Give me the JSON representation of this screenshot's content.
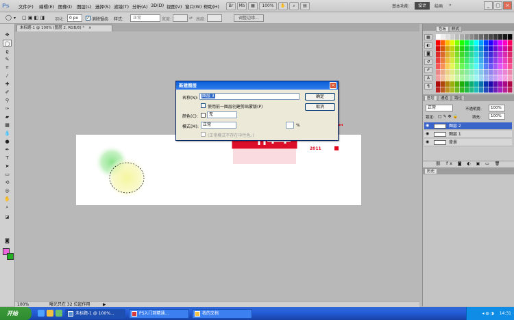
{
  "app": {
    "logo": "Ps"
  },
  "menu": [
    "文件(F)",
    "编辑(E)",
    "图像(I)",
    "图层(L)",
    "选择(S)",
    "滤镜(T)",
    "分析(A)",
    "3D(D)",
    "视图(V)",
    "窗口(W)",
    "帮助(H)"
  ],
  "menu_right": {
    "zoom": "100%",
    "workspaces": [
      "基本功能",
      "设计",
      "绘画"
    ],
    "active_workspace": "设计"
  },
  "options": {
    "feather_label": "羽化:",
    "feather_value": "0 px",
    "antialias_label": "消除锯齿",
    "style_label": "样式:",
    "style_value": "正常",
    "width_label": "宽度:",
    "height_label": "高度:",
    "refine_label": "调整边缘..."
  },
  "document_tab": {
    "title": "未标题-1 @ 100% (图层 2, RGB/8) *",
    "close": "×"
  },
  "status": {
    "zoom": "100%",
    "info": "曝光只在 32 位起作用"
  },
  "panels": {
    "swatches_tabs": [
      "色板",
      "样式"
    ],
    "layers_tabs": [
      "图层",
      "通道",
      "路径"
    ],
    "blend_mode": "正常",
    "opacity_label": "不透明度:",
    "opacity_value": "100%",
    "lock_label": "锁定:",
    "fill_label": "填充:",
    "fill_value": "100%",
    "layers": [
      {
        "name": "图层 2",
        "selected": true
      },
      {
        "name": "图层 1",
        "selected": false
      },
      {
        "name": "背景",
        "selected": false
      }
    ],
    "history_tab": "历史"
  },
  "dialog": {
    "title": "新建图层",
    "name_label": "名称(N):",
    "name_value": "图层 3",
    "clip_label": "使用前一图层创建剪贴蒙版(P)",
    "color_label": "颜色(C):",
    "color_value": "无",
    "mode_label": "模式(M):",
    "mode_value": "正常",
    "opacity_unit": "%",
    "neutral_label": "(正常模式不存在中性色。)",
    "ok_label": "确定",
    "cancel_label": "取消",
    "close": "×"
  },
  "if_logo": {
    "mark": "iF",
    "line1": "communication",
    "line2": "design",
    "line3": "award",
    "year": "2011"
  },
  "taskbar": {
    "start_label": "开始",
    "buttons": [
      {
        "label": "未标题-1 @ 100%...",
        "active": true
      },
      {
        "label": "PS入门到精通...",
        "active": false
      },
      {
        "label": "我的文档",
        "active": false
      }
    ],
    "clock": "14:31"
  },
  "colors": {
    "foreground": "#ee66dd",
    "background": "#22b022",
    "seal": "#dd0e2a",
    "if_red": "#e3051b"
  }
}
